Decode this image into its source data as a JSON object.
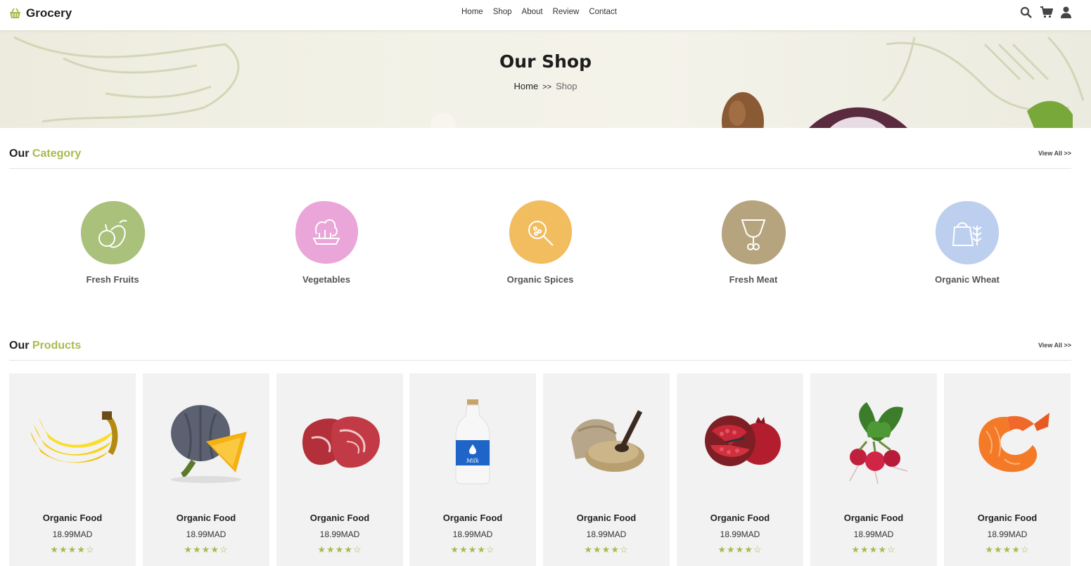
{
  "brand": {
    "name": "Grocery",
    "icon": "basket-icon"
  },
  "nav": {
    "links": [
      "Home",
      "Shop",
      "About",
      "Review",
      "Contact"
    ],
    "icons": [
      "search-icon",
      "cart-icon",
      "user-icon"
    ]
  },
  "hero": {
    "title": "Our Shop",
    "breadcrumb": {
      "home": "Home",
      "sep": ">>",
      "current": "Shop"
    }
  },
  "category": {
    "title_plain": "Our",
    "title_accent": "Category",
    "view_all": "View All >>",
    "items": [
      {
        "label": "Fresh Fruits",
        "icon": "fruits-icon",
        "color": "#a9c17a"
      },
      {
        "label": "Vegetables",
        "icon": "vegetables-icon",
        "color": "#eaa5d9"
      },
      {
        "label": "Organic Spices",
        "icon": "spices-icon",
        "color": "#f1bd5f"
      },
      {
        "label": "Fresh Meat",
        "icon": "meat-icon",
        "color": "#b6a47e"
      },
      {
        "label": "Organic Wheat",
        "icon": "wheat-icon",
        "color": "#bccfee"
      }
    ]
  },
  "products": {
    "title_plain": "Our",
    "title_accent": "Products",
    "view_all": "View All >>",
    "items": [
      {
        "name": "Organic Food",
        "price": "18.99MAD",
        "rating": 4,
        "image": "bananas"
      },
      {
        "name": "Organic Food",
        "price": "18.99MAD",
        "rating": 4,
        "image": "pumpkin"
      },
      {
        "name": "Organic Food",
        "price": "18.99MAD",
        "rating": 4,
        "image": "beef-steak"
      },
      {
        "name": "Organic Food",
        "price": "18.99MAD",
        "rating": 4,
        "image": "milk-bottle"
      },
      {
        "name": "Organic Food",
        "price": "18.99MAD",
        "rating": 4,
        "image": "grain-sack"
      },
      {
        "name": "Organic Food",
        "price": "18.99MAD",
        "rating": 4,
        "image": "pomegranate"
      },
      {
        "name": "Organic Food",
        "price": "18.99MAD",
        "rating": 4,
        "image": "radishes"
      },
      {
        "name": "Organic Food",
        "price": "18.99MAD",
        "rating": 4,
        "image": "shrimp"
      }
    ],
    "milk_label": "Milk"
  },
  "colors": {
    "accent": "#a9ba4e",
    "card_bg": "#f2f2f2"
  }
}
